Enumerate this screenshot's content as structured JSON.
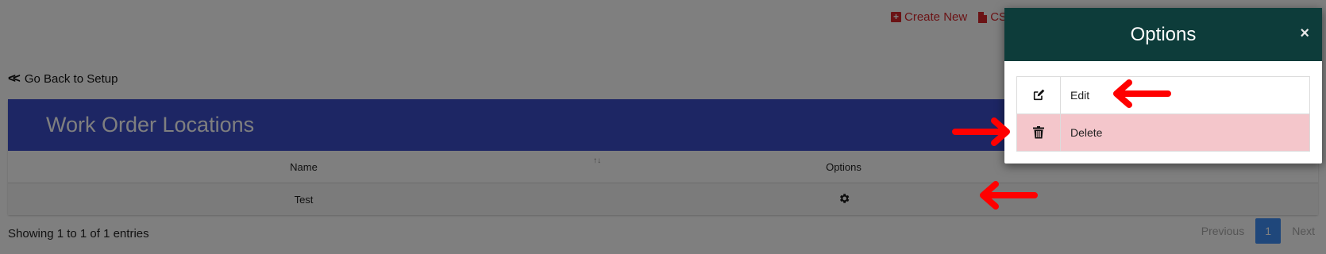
{
  "top_actions": {
    "create_new": "Create New",
    "csv": "CSV"
  },
  "back_link": "Go Back to Setup",
  "card": {
    "title": "Work Order Locations",
    "columns": {
      "name": "Name",
      "options": "Options"
    },
    "rows": [
      {
        "name": "Test"
      }
    ]
  },
  "footer": {
    "info": "Showing 1 to 1 of 1 entries",
    "pager": {
      "previous": "Previous",
      "page": "1",
      "next": "Next"
    }
  },
  "modal": {
    "title": "Options",
    "close": "×",
    "items": [
      {
        "label": "Edit",
        "icon": "edit-icon"
      },
      {
        "label": "Delete",
        "icon": "trash-icon"
      }
    ]
  },
  "colors": {
    "accent_red": "#d6262b",
    "header_blue": "#3a4cc8",
    "modal_header": "#0d3c3a",
    "delete_bg": "#f4c6cb",
    "pager_blue": "#3e8ef7"
  }
}
